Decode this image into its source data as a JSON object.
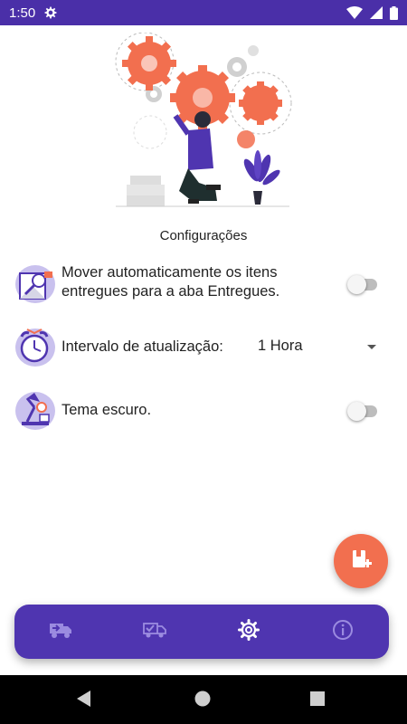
{
  "status_bar": {
    "time": "1:50"
  },
  "page": {
    "title": "Configurações"
  },
  "settings": {
    "auto_move": {
      "label": "Mover automaticamente os itens entregues para a aba Entregues.",
      "enabled": false
    },
    "refresh_interval": {
      "label": "Intervalo de atualização:",
      "value": "1 Hora"
    },
    "dark_theme": {
      "label": "Tema escuro.",
      "enabled": false
    }
  },
  "bottom_nav": {
    "items": [
      {
        "id": "in-transit",
        "icon": "truck-icon"
      },
      {
        "id": "delivered",
        "icon": "truck-check-icon"
      },
      {
        "id": "settings",
        "icon": "gear-icon",
        "active": true
      },
      {
        "id": "about",
        "icon": "info-icon"
      }
    ]
  },
  "colors": {
    "primary": "#4f35b0",
    "status_bar": "#4a2fa8",
    "accent": "#f26f4f",
    "toggle_off": "#bdbdbd"
  }
}
